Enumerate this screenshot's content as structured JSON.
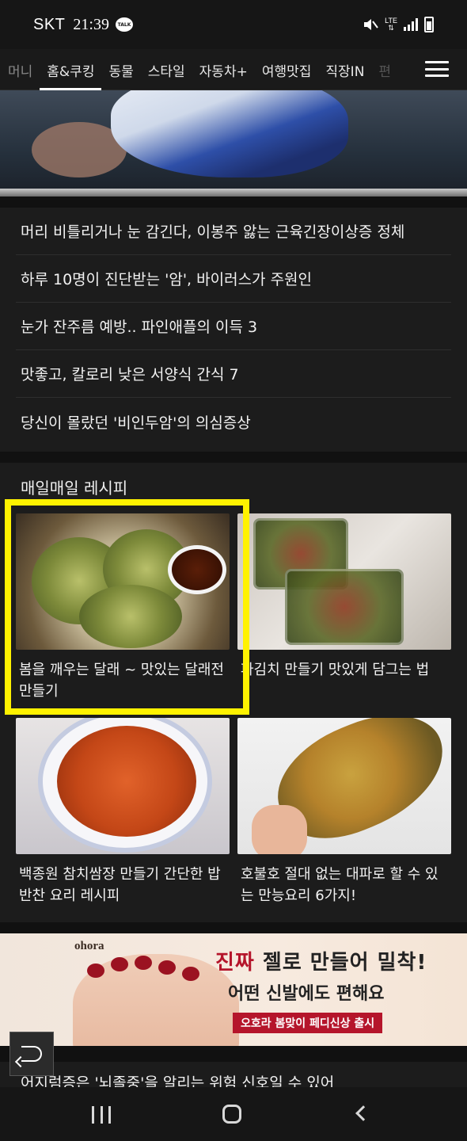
{
  "status_bar": {
    "carrier": "SKT",
    "time": "21:39",
    "talk_badge": "TALK",
    "network": "LTE",
    "icons": [
      "kakaotalk-icon",
      "mute-icon",
      "signal-icon",
      "battery-charging-icon"
    ]
  },
  "nav": {
    "tabs": [
      {
        "label": "머니"
      },
      {
        "label": "홈&쿠킹",
        "active": true
      },
      {
        "label": "동물"
      },
      {
        "label": "스타일"
      },
      {
        "label": "자동차+"
      },
      {
        "label": "여행맛집"
      },
      {
        "label": "직장IN"
      },
      {
        "label": "편"
      }
    ],
    "menu_icon": "hamburger-menu-icon"
  },
  "headlines": [
    "머리 비틀리거나 눈 감긴다, 이봉주 앓는 근육긴장이상증 정체",
    "하루 10명이 진단받는 '암', 바이러스가 주원인",
    "눈가 잔주름 예방.. 파인애플의 이득 3",
    "맛좋고, 칼로리 낮은 서양식 간식 7",
    "당신이 몰랐던 '비인두암'의 의심증상"
  ],
  "recipes": {
    "title": "매일매일 레시피",
    "cards": [
      {
        "caption": "봄을 깨우는 달래 ~ 맛있는 달래전 만들기",
        "highlighted": true
      },
      {
        "caption": "파김치 만들기 맛있게 담그는 법"
      },
      {
        "caption": "백종원 참치쌈장 만들기 간단한 밥반찬 요리 레시피"
      },
      {
        "caption": "호불호 절대 없는 대파로 할 수 있는 만능요리 6가지!"
      }
    ]
  },
  "ad": {
    "brand": "ohora",
    "line1_a": "진짜",
    "line1_b": " 젤로 만들어 밀착!",
    "line2": "어떤 신발에도 편해요",
    "pill": "오호라 봄맞이 페디신상 출시"
  },
  "teaser": "어지럼증은 '뇌졸중'을 알리는 위험 신호일 수 있어",
  "colors": {
    "highlight": "#fff200",
    "background": "#1c1c1c",
    "ad_accent": "#b5152b"
  }
}
